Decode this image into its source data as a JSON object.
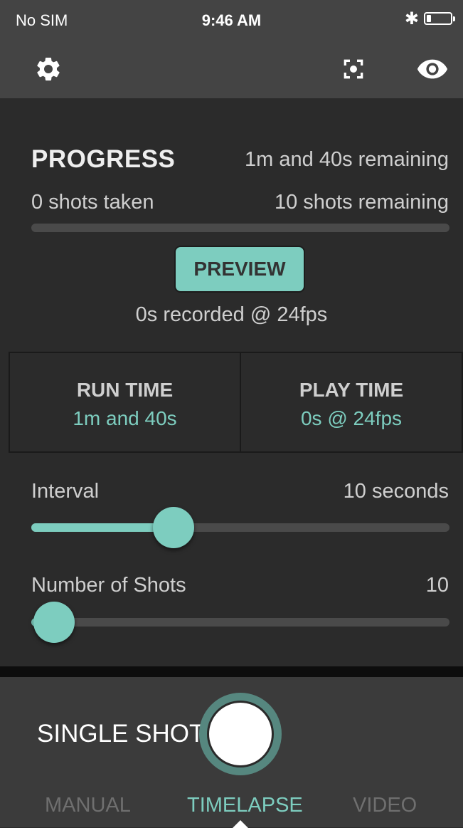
{
  "status_bar": {
    "carrier": "No SIM",
    "time": "9:46 AM",
    "bluetooth_glyph": "✱",
    "battery_level": 0.2
  },
  "toolbar": {
    "settings_icon": "gear-icon",
    "focus_icon": "focus-frame-icon",
    "preview_icon": "eye-icon"
  },
  "progress": {
    "title": "PROGRESS",
    "time_remaining": "1m and 40s remaining",
    "shots_taken": "0 shots taken",
    "shots_remaining": "10 shots remaining",
    "progress_fraction": 0.0,
    "preview_label": "PREVIEW",
    "recorded": "0s recorded @ 24fps"
  },
  "times": {
    "run_time_label": "RUN TIME",
    "run_time_value": "1m and 40s",
    "play_time_label": "PLAY TIME",
    "play_time_value": "0s @ 24fps"
  },
  "settings": {
    "interval_label": "Interval",
    "interval_value": "10 seconds",
    "interval_fraction": 0.34,
    "shots_label": "Number of Shots",
    "shots_value": "10",
    "shots_fraction": 0.055
  },
  "capture": {
    "single_shot_label": "SINGLE SHOT"
  },
  "modes": {
    "manual": "MANUAL",
    "timelapse": "TIMELAPSE",
    "video": "VIDEO",
    "active": "timelapse"
  },
  "colors": {
    "accent": "#7dcdbf",
    "background": "#2b2b2b",
    "header": "#444444"
  }
}
